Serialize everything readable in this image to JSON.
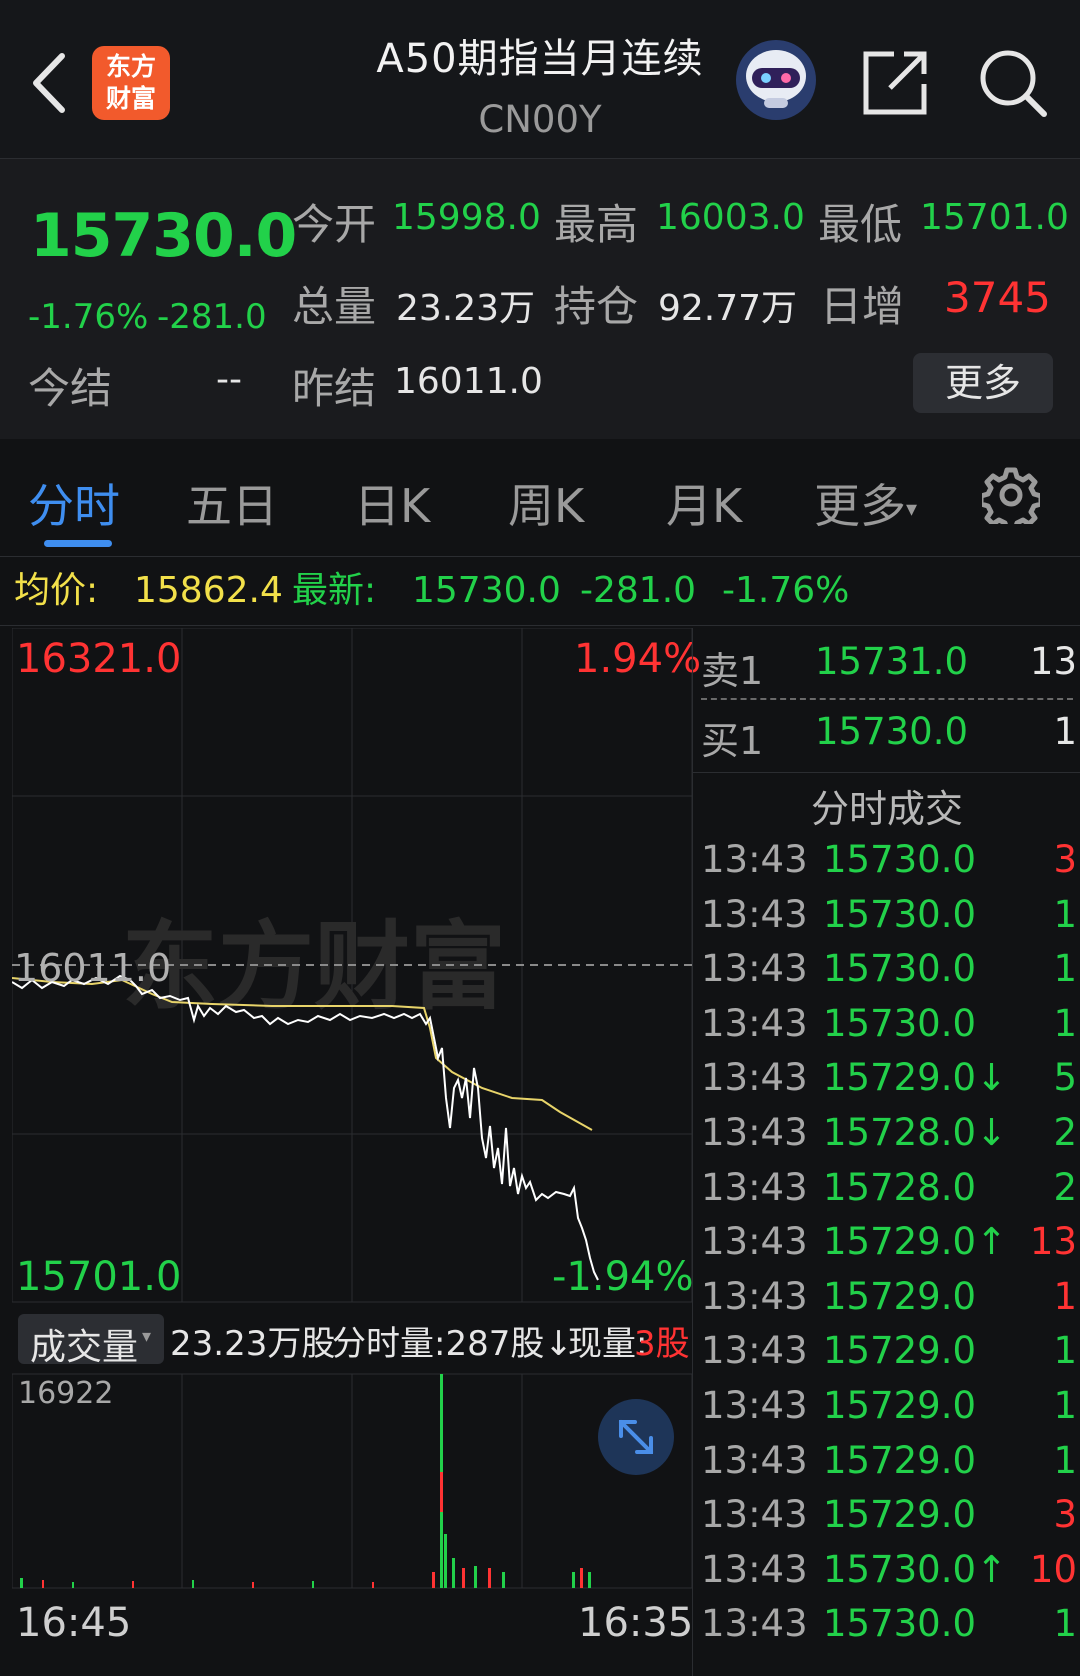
{
  "header": {
    "logo_line1": "东方",
    "logo_line2": "财富",
    "title": "A50期指当月连续",
    "code": "CN00Y"
  },
  "quote": {
    "last_price": "15730.0",
    "change_pct": "-1.76%",
    "change": "-281.0",
    "open_label": "今开",
    "open": "15998.0",
    "high_label": "最高",
    "high": "16003.0",
    "low_label": "最低",
    "low": "15701.0",
    "volume_label": "总量",
    "volume": "23.23万",
    "oi_label": "持仓",
    "oi": "92.77万",
    "daily_inc_label": "日增",
    "daily_inc": "3745",
    "settle_label": "今结",
    "settle": "--",
    "prev_settle_label": "昨结",
    "prev_settle": "16011.0",
    "more_label": "更多"
  },
  "tabs": {
    "t1": "分时",
    "t2": "五日",
    "t3": "日K",
    "t4": "周K",
    "t5": "月K",
    "t6": "更多"
  },
  "info": {
    "avg_label": "均价:",
    "avg": "15862.4",
    "latest_label": "最新:",
    "latest": "15730.0",
    "chg": "-281.0",
    "pct": "-1.76%"
  },
  "chart": {
    "upper_price": "16321.0",
    "upper_pct": "1.94%",
    "ref_price": "16011.0",
    "lower_price": "15701.0",
    "lower_pct": "-1.94%",
    "watermark": "东方财富",
    "vol_selector": "成交量",
    "vol_total": "23.23万股",
    "vol_period": "分时量:287股↓",
    "vol_now_label": "现量:",
    "vol_now": "3股",
    "vol_max": "16922",
    "time_start": "16:45",
    "time_end": "16:35"
  },
  "order_book": {
    "ask_label": "卖1",
    "ask_price": "15731.0",
    "ask_vol": "13",
    "bid_label": "买1",
    "bid_price": "15730.0",
    "bid_vol": "1",
    "trades_title": "分时成交",
    "trades": [
      {
        "time": "13:43",
        "price": "15730.0",
        "vol": "3",
        "pc": "g",
        "vc": "r"
      },
      {
        "time": "13:43",
        "price": "15730.0",
        "vol": "1",
        "pc": "g",
        "vc": "g"
      },
      {
        "time": "13:43",
        "price": "15730.0",
        "vol": "1",
        "pc": "g",
        "vc": "g"
      },
      {
        "time": "13:43",
        "price": "15730.0",
        "vol": "1",
        "pc": "g",
        "vc": "g"
      },
      {
        "time": "13:43",
        "price": "15729.0↓",
        "vol": "5",
        "pc": "g",
        "vc": "g"
      },
      {
        "time": "13:43",
        "price": "15728.0↓",
        "vol": "2",
        "pc": "g",
        "vc": "g"
      },
      {
        "time": "13:43",
        "price": "15728.0",
        "vol": "2",
        "pc": "g",
        "vc": "g"
      },
      {
        "time": "13:43",
        "price": "15729.0↑",
        "vol": "13",
        "pc": "g",
        "vc": "r"
      },
      {
        "time": "13:43",
        "price": "15729.0",
        "vol": "1",
        "pc": "g",
        "vc": "r"
      },
      {
        "time": "13:43",
        "price": "15729.0",
        "vol": "1",
        "pc": "g",
        "vc": "g"
      },
      {
        "time": "13:43",
        "price": "15729.0",
        "vol": "1",
        "pc": "g",
        "vc": "g"
      },
      {
        "time": "13:43",
        "price": "15729.0",
        "vol": "1",
        "pc": "g",
        "vc": "g"
      },
      {
        "time": "13:43",
        "price": "15729.0",
        "vol": "3",
        "pc": "g",
        "vc": "r"
      },
      {
        "time": "13:43",
        "price": "15730.0↑",
        "vol": "10",
        "pc": "g",
        "vc": "r"
      },
      {
        "time": "13:43",
        "price": "15730.0",
        "vol": "1",
        "pc": "g",
        "vc": "g"
      }
    ]
  },
  "colors": {
    "up": "#ff3333",
    "down": "#22d14a",
    "accent": "#3f8ef0",
    "avg": "#f2e04a"
  }
}
